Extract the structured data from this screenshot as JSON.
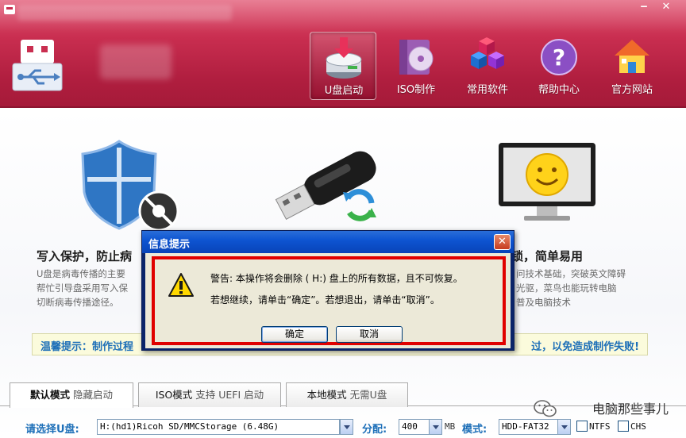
{
  "nav": [
    {
      "label": "U盘启动",
      "icon": "usb-disk-icon"
    },
    {
      "label": "ISO制作",
      "icon": "iso-disc-icon"
    },
    {
      "label": "常用软件",
      "icon": "software-cubes-icon"
    },
    {
      "label": "帮助中心",
      "icon": "help-icon"
    },
    {
      "label": "官方网站",
      "icon": "home-icon"
    }
  ],
  "features": [
    {
      "title": "写入保护，防止病",
      "desc": [
        "U盘是病毒传播的主要",
        "帮忙引导盘采用写入保",
        "切断病毒传播途径。"
      ]
    },
    {
      "title": "锁，简单易用",
      "desc": [
        "问技术基础，突破英文障碍",
        "光驱，菜鸟也能玩转电脑",
        "普及电脑技术"
      ]
    }
  ],
  "tip": {
    "left": "温馨提示：制作过程",
    "right": "过，以免造成制作失败!"
  },
  "tabs": [
    {
      "main": "默认模式",
      "sub": "隐藏启动"
    },
    {
      "main": "ISO模式",
      "sub": "支持 UEFI 启动"
    },
    {
      "main": "本地模式",
      "sub": "无需U盘"
    }
  ],
  "bottom": {
    "disk_label": "请选择U盘:",
    "disk_value": "H:(hd1)Ricoh SD/MMCStorage (6.48G)",
    "alloc_label": "分配:",
    "alloc_value": "400",
    "alloc_unit": "MB",
    "mode_label": "模式:",
    "mode_value": "HDD-FAT32",
    "ntfs_label": "NTFS",
    "chs_label": "CHS"
  },
  "watermark": "电脑那些事儿",
  "dialog": {
    "title": "信息提示",
    "line1": "警告: 本操作将会删除 ( H:) 盘上的所有数据，且不可恢复。",
    "line2": "若想继续，请单击“确定”。若想退出，请单击“取消”。",
    "ok_label": "确定",
    "cancel_label": "取消"
  },
  "colors": {
    "header": "#b8233f",
    "accent": "#1d6fb8",
    "highlight": "#e00000"
  }
}
